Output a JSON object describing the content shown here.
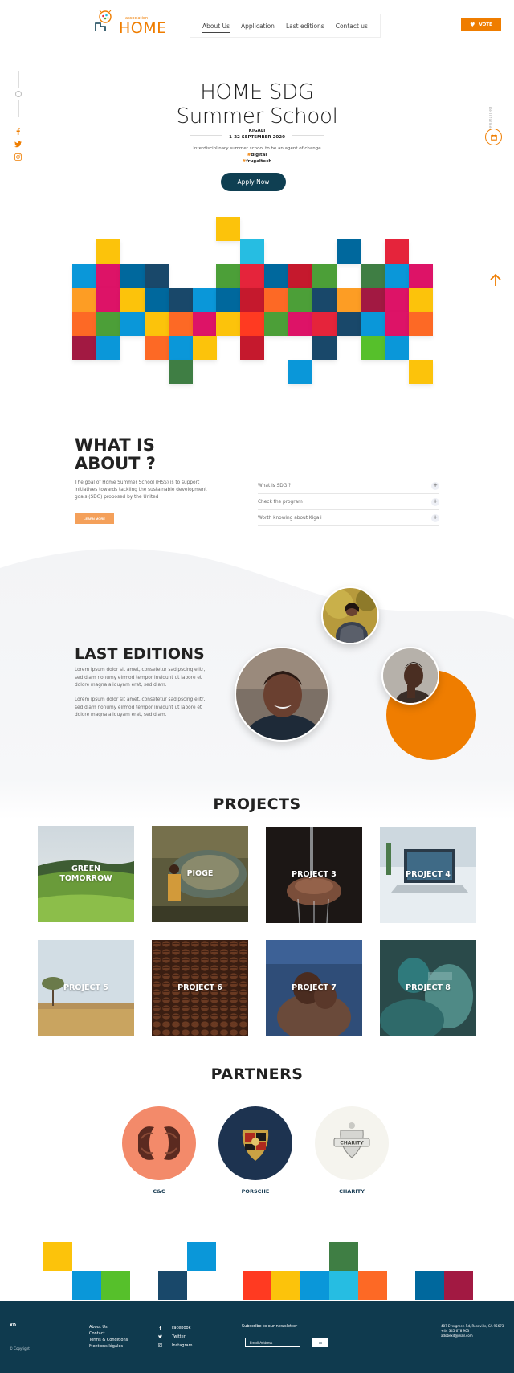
{
  "header": {
    "logo_small": "association",
    "logo_text": "HOME",
    "nav": [
      "About Us",
      "Application",
      "Last editions",
      "Contact us"
    ],
    "vote_label": "VOTE"
  },
  "right_rail": {
    "vertical_text": "Be Informed"
  },
  "hero": {
    "title_line1": "HOME SDG",
    "title_line2": "Summer School",
    "city": "KIGALI",
    "dates": "1-22 SEPTEMBER 2020",
    "description": "Interdisciplinary summer school to be an agent of change",
    "tags": [
      "digital",
      "frugaltech"
    ],
    "hash": "#",
    "apply_label": "Apply Now"
  },
  "about": {
    "title_line1": "WHAT IS",
    "title_line2": "ABOUT ?",
    "text": "The goal of Home Summer School (HSS) is to support initiatives towards tackling the sustainable development goals (SDG) proposed by the United",
    "learn_label": "LEARN MORE",
    "accordion": [
      "What is SDG ?",
      "Check the program",
      "Worth knowing about Kigali"
    ]
  },
  "last_editions": {
    "title": "LAST EDITIONS",
    "paragraphs": [
      "Lorem ipsum dolor sit amet, consetetur sadipscing elitr, sed diam nonumy eirmod tempor invidunt ut labore et dolore magna aliquyam erat, sed diam.",
      "Lorem ipsum dolor sit amet, consetetur sadipscing elitr, sed diam nonumy eirmod tempor invidunt ut labore et dolore magna aliquyam erat, sed diam."
    ]
  },
  "projects": {
    "title": "PROJECTS",
    "items": [
      "GREEN TOMORROW",
      "PIOGE",
      "PROJECT 3",
      "PROJECT 4",
      "PROJECT 5",
      "PROJECT 6",
      "PROJECT 7",
      "PROJECT 8"
    ]
  },
  "partners": {
    "title": "PARTNERS",
    "items": [
      "C&C",
      "PORSCHE",
      "CHARITY"
    ],
    "charity_badge": "CHARITY"
  },
  "footer": {
    "brand": "XD",
    "copyright": "© Copyright",
    "links": [
      "About Us",
      "Contact",
      "Terms & Conditions",
      "Mentions légales"
    ],
    "social": [
      "Facebook",
      "Twitter",
      "Instagram"
    ],
    "newsletter_label": "Subscribe to our newsletter",
    "email_placeholder": "Email Address",
    "ok_label": "ok",
    "address": [
      "487 Evergreen Rd, Roseville, CA 95673",
      "+44 345 678 903",
      "adobexd@mail.com"
    ]
  },
  "colors": {
    "accent": "#ef7d00",
    "navy": "#0f3f52",
    "footer_bg": "#0f3a4e",
    "sdg": [
      "#e5243b",
      "#dda63a",
      "#4c9f38",
      "#c5192d",
      "#ff3a21",
      "#26bde2",
      "#fcc30b",
      "#a21942",
      "#fd6925",
      "#dd1367",
      "#fd9d24",
      "#bf8b2e",
      "#3f7e44",
      "#0a97d9",
      "#56c02b",
      "#00689d",
      "#19486a"
    ]
  }
}
